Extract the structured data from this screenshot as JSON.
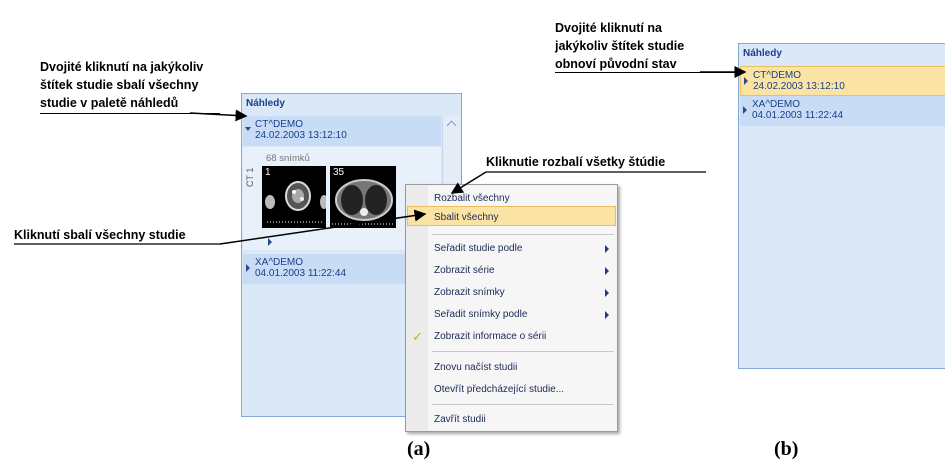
{
  "callouts": {
    "left_top": "Dvojité kliknutí na jakýkoliv\nštítek studie sbalí všechny\nstudie v paletě náhledů",
    "left_mid": "Kliknutí sbalí všechny studie",
    "center": "Kliknutie rozbalí všetky štúdie",
    "right_top": "Dvojité kliknutí na\njakýkoliv štítek studie\nobnoví původní stav"
  },
  "panel_a": {
    "title": "Náhledy",
    "study1": {
      "name": "CT^DEMO",
      "datetime": "24.02.2003 13:12:10"
    },
    "series": {
      "count_label": "68 snímků",
      "modality": "CT 1",
      "thumb1_label": "1",
      "thumb2_label": "35"
    },
    "study2": {
      "name": "XA^DEMO",
      "datetime": "04.01.2003 11:22:44"
    }
  },
  "context_menu": {
    "items": [
      "Rozbalit všechny",
      "Sbalit všechny",
      "Seřadit studie podle",
      "Zobrazit série",
      "Zobrazit snímky",
      "Seřadit snímky podle",
      "Zobrazit informace o sérii",
      "Znovu načíst studii",
      "Otevřít předcházející studie...",
      "Zavřít studii"
    ],
    "check_mark": "✓"
  },
  "panel_b": {
    "title": "Náhledy",
    "study1": {
      "name": "CT^DEMO",
      "datetime": "24.02.2003 13:12:10"
    },
    "study2": {
      "name": "XA^DEMO",
      "datetime": "04.01.2003 11:22:44"
    }
  },
  "labels": {
    "a": "(a)",
    "b": "(b)"
  },
  "colors": {
    "panel_bg": "#dbe8f8",
    "selected": "#fbe4a3",
    "title_text": "#1a3f8a"
  }
}
